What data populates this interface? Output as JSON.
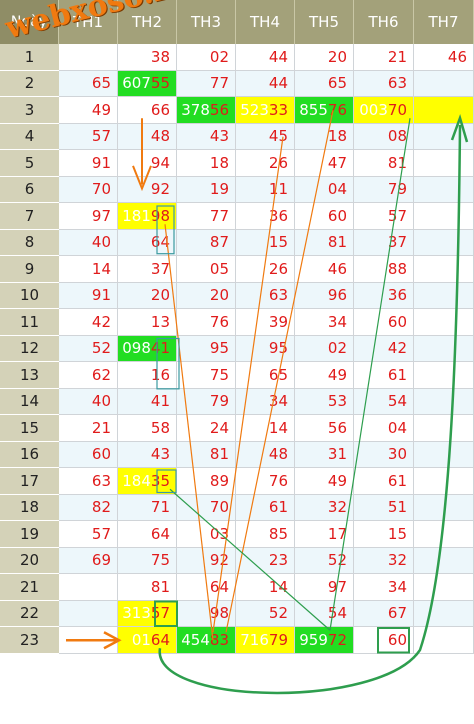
{
  "header": {
    "day_label": "Ngày",
    "columns": [
      "TH1",
      "TH2",
      "TH3",
      "TH4",
      "TH5",
      "TH6",
      "TH7"
    ]
  },
  "logo_text": "webxoso.net",
  "rows": [
    {
      "day": "1",
      "cells": [
        "",
        "38",
        "02",
        "44",
        "20",
        "21",
        "46"
      ]
    },
    {
      "day": "2",
      "cells": [
        "65",
        "607|55",
        "77",
        "44",
        "65",
        "63",
        ""
      ]
    },
    {
      "day": "3",
      "cells": [
        "49",
        "66",
        "378|56",
        "523|33",
        "855|76",
        "003|70",
        ""
      ]
    },
    {
      "day": "4",
      "cells": [
        "57",
        "48",
        "43",
        "45",
        "18",
        "08",
        ""
      ]
    },
    {
      "day": "5",
      "cells": [
        "91",
        "94",
        "18",
        "26",
        "47",
        "81",
        ""
      ]
    },
    {
      "day": "6",
      "cells": [
        "70",
        "92",
        "19",
        "11",
        "04",
        "79",
        ""
      ]
    },
    {
      "day": "7",
      "cells": [
        "97",
        "181|98",
        "77",
        "36",
        "60",
        "57",
        ""
      ]
    },
    {
      "day": "8",
      "cells": [
        "40",
        "64",
        "87",
        "15",
        "81",
        "37",
        ""
      ]
    },
    {
      "day": "9",
      "cells": [
        "14",
        "37",
        "05",
        "26",
        "46",
        "88",
        ""
      ]
    },
    {
      "day": "10",
      "cells": [
        "91",
        "20",
        "20",
        "63",
        "96",
        "36",
        ""
      ]
    },
    {
      "day": "11",
      "cells": [
        "42",
        "13",
        "76",
        "39",
        "34",
        "60",
        ""
      ]
    },
    {
      "day": "12",
      "cells": [
        "52",
        "098|41",
        "95",
        "95",
        "02",
        "42",
        ""
      ]
    },
    {
      "day": "13",
      "cells": [
        "62",
        "16",
        "75",
        "65",
        "49",
        "61",
        ""
      ]
    },
    {
      "day": "14",
      "cells": [
        "40",
        "41",
        "79",
        "34",
        "53",
        "54",
        ""
      ]
    },
    {
      "day": "15",
      "cells": [
        "21",
        "58",
        "24",
        "14",
        "56",
        "04",
        ""
      ]
    },
    {
      "day": "16",
      "cells": [
        "60",
        "43",
        "81",
        "48",
        "31",
        "30",
        ""
      ]
    },
    {
      "day": "17",
      "cells": [
        "63",
        "184|35",
        "89",
        "76",
        "49",
        "61",
        ""
      ]
    },
    {
      "day": "18",
      "cells": [
        "82",
        "71",
        "70",
        "61",
        "32",
        "51",
        ""
      ]
    },
    {
      "day": "19",
      "cells": [
        "57",
        "64",
        "03",
        "85",
        "17",
        "15",
        ""
      ]
    },
    {
      "day": "20",
      "cells": [
        "69",
        "75",
        "92",
        "23",
        "52",
        "32",
        ""
      ]
    },
    {
      "day": "21",
      "cells": [
        "",
        "81",
        "64",
        "14",
        "97",
        "34",
        ""
      ]
    },
    {
      "day": "22",
      "cells": [
        "",
        "313|57",
        "98",
        "52",
        "54",
        "67",
        ""
      ]
    },
    {
      "day": "23",
      "cells": [
        "",
        "01|64",
        "454|83",
        "716|79",
        "959|72",
        "60",
        ""
      ]
    }
  ],
  "highlights": {
    "green": [
      "2-1",
      "3-2",
      "3-4",
      "12-1",
      "23-2",
      "23-4"
    ],
    "yellow": [
      "3-3",
      "3-5",
      "3-6",
      "7-1",
      "17-1",
      "22-1",
      "23-1",
      "23-3"
    ]
  },
  "colors": {
    "header": "#a3a17a",
    "rowlabel": "#d4d2b8",
    "number": "#e01b1b",
    "green": "#22dd22",
    "yellow": "#ffff00",
    "orange": "#f07a10",
    "overlay_green": "#2e9e4e"
  }
}
